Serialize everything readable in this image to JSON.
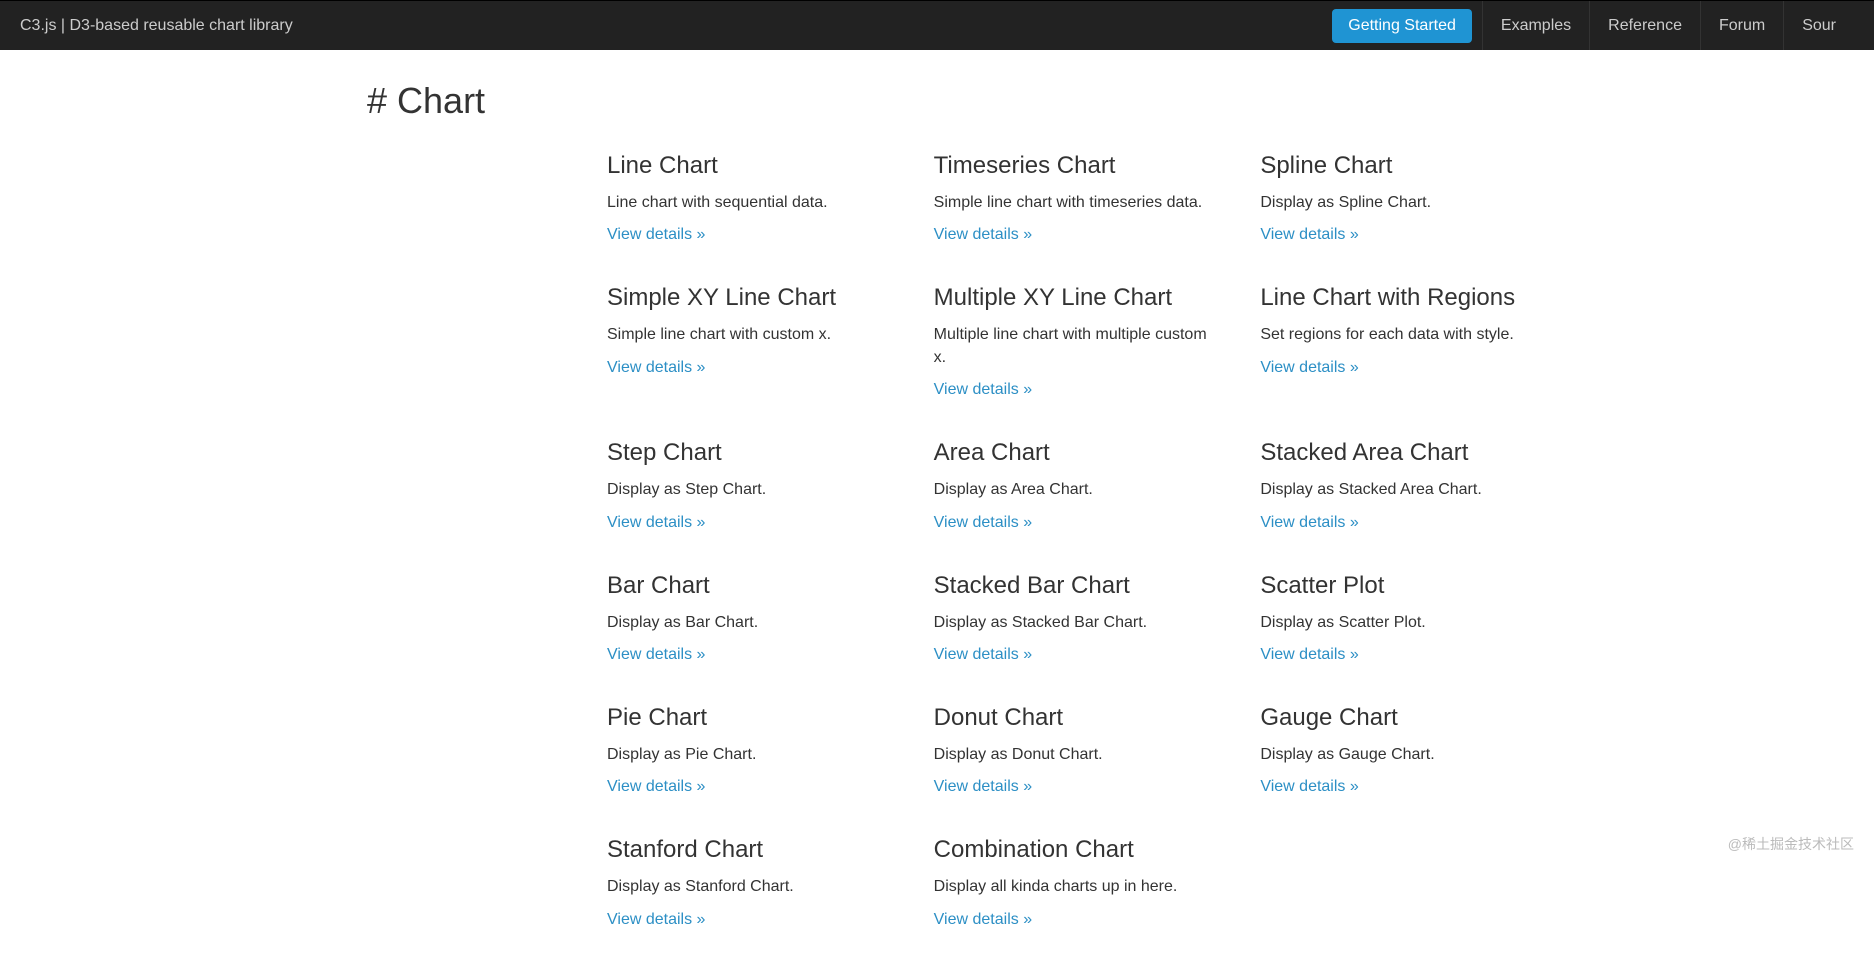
{
  "navbar": {
    "brand": "C3.js | D3-based reusable chart library",
    "links": {
      "getting_started": "Getting Started",
      "examples": "Examples",
      "reference": "Reference",
      "forum": "Forum",
      "source": "Sour"
    }
  },
  "page": {
    "title": "# Chart"
  },
  "view_details": "View details »",
  "items": [
    {
      "title": "Line Chart",
      "desc": "Line chart with sequential data."
    },
    {
      "title": "Timeseries Chart",
      "desc": "Simple line chart with timeseries data."
    },
    {
      "title": "Spline Chart",
      "desc": "Display as Spline Chart."
    },
    {
      "title": "Simple XY Line Chart",
      "desc": "Simple line chart with custom x."
    },
    {
      "title": "Multiple XY Line Chart",
      "desc": "Multiple line chart with multiple custom x."
    },
    {
      "title": "Line Chart with Regions",
      "desc": "Set regions for each data with style."
    },
    {
      "title": "Step Chart",
      "desc": "Display as Step Chart."
    },
    {
      "title": "Area Chart",
      "desc": "Display as Area Chart."
    },
    {
      "title": "Stacked Area Chart",
      "desc": "Display as Stacked Area Chart."
    },
    {
      "title": "Bar Chart",
      "desc": "Display as Bar Chart."
    },
    {
      "title": "Stacked Bar Chart",
      "desc": "Display as Stacked Bar Chart."
    },
    {
      "title": "Scatter Plot",
      "desc": "Display as Scatter Plot."
    },
    {
      "title": "Pie Chart",
      "desc": "Display as Pie Chart."
    },
    {
      "title": "Donut Chart",
      "desc": "Display as Donut Chart."
    },
    {
      "title": "Gauge Chart",
      "desc": "Display as Gauge Chart."
    },
    {
      "title": "Stanford Chart",
      "desc": "Display as Stanford Chart."
    },
    {
      "title": "Combination Chart",
      "desc": "Display all kinda charts up in here."
    }
  ],
  "watermark": "@稀土掘金技术社区"
}
